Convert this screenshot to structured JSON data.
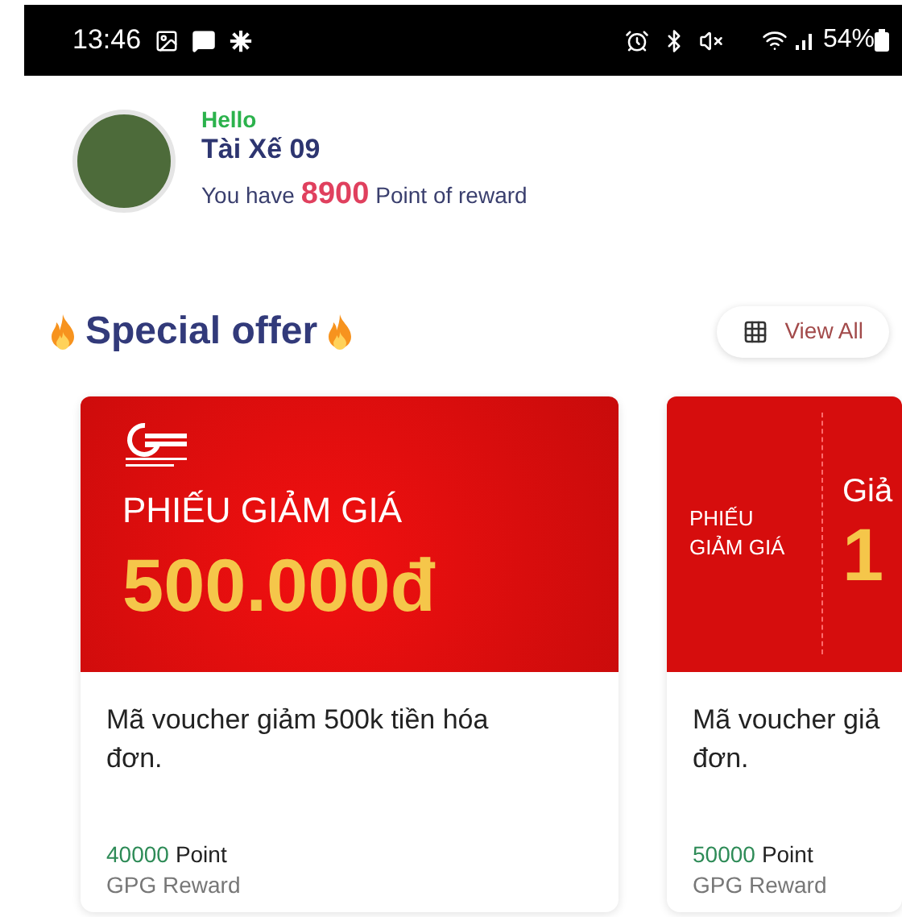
{
  "status_bar": {
    "time": "13:46",
    "battery": "54%"
  },
  "profile": {
    "greeting": "Hello",
    "name": "Tài Xế 09",
    "points_prefix": "You have",
    "points": "8900",
    "points_suffix": "Point of reward"
  },
  "section": {
    "title": "Special offer",
    "view_all": "View All"
  },
  "vouchers": [
    {
      "kind": "wide",
      "banner_title": "PHIẾU GIẢM GIÁ",
      "banner_amount": "500.000đ",
      "description_lines": [
        "Mã voucher giảm 500k tiền hóa",
        "đơn."
      ],
      "points": "40000",
      "points_unit": "Point",
      "provider": "GPG Reward"
    },
    {
      "kind": "split",
      "banner_title": "PHIẾU GIẢM GIÁ",
      "banner_side_title": "Giả",
      "banner_amount": "1",
      "description_lines": [
        "Mã voucher giả",
        "đơn."
      ],
      "points": "50000",
      "points_unit": "Point",
      "provider": "GPG Reward"
    }
  ]
}
